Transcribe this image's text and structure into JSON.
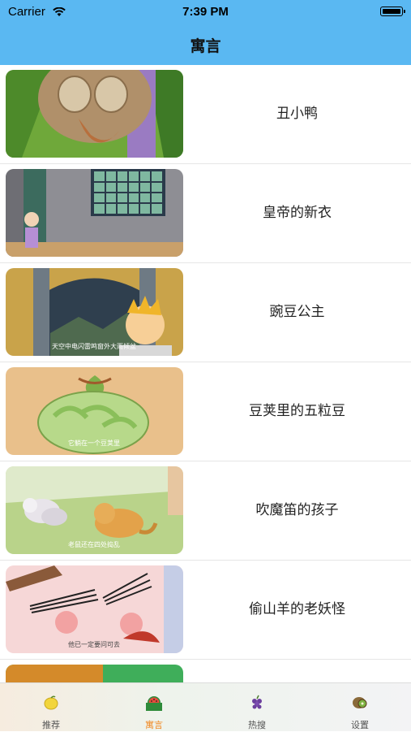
{
  "status_bar": {
    "carrier": "Carrier",
    "time": "7:39 PM"
  },
  "header": {
    "title": "寓言"
  },
  "stories": [
    {
      "title": "丑小鸭"
    },
    {
      "title": "皇帝的新衣"
    },
    {
      "title": "豌豆公主",
      "caption": "天空中电闪雷鸣窗外大雨倾盆"
    },
    {
      "title": "豆荚里的五粒豆",
      "caption": "它躺在一个豆荚里"
    },
    {
      "title": "吹魔笛的孩子",
      "caption": "老鼠还在四处捣乱"
    },
    {
      "title": "偷山羊的老妖怪",
      "caption": "他已一定要问可去"
    },
    {
      "title": ""
    }
  ],
  "tabs": [
    {
      "label": "推荐",
      "icon": "lemon-icon"
    },
    {
      "label": "寓言",
      "icon": "watermelon-icon",
      "active": true
    },
    {
      "label": "热搜",
      "icon": "grapes-icon"
    },
    {
      "label": "设置",
      "icon": "kiwi-icon"
    }
  ],
  "colors": {
    "nav": "#5ab8f2",
    "tab_active": "#f08a24"
  }
}
